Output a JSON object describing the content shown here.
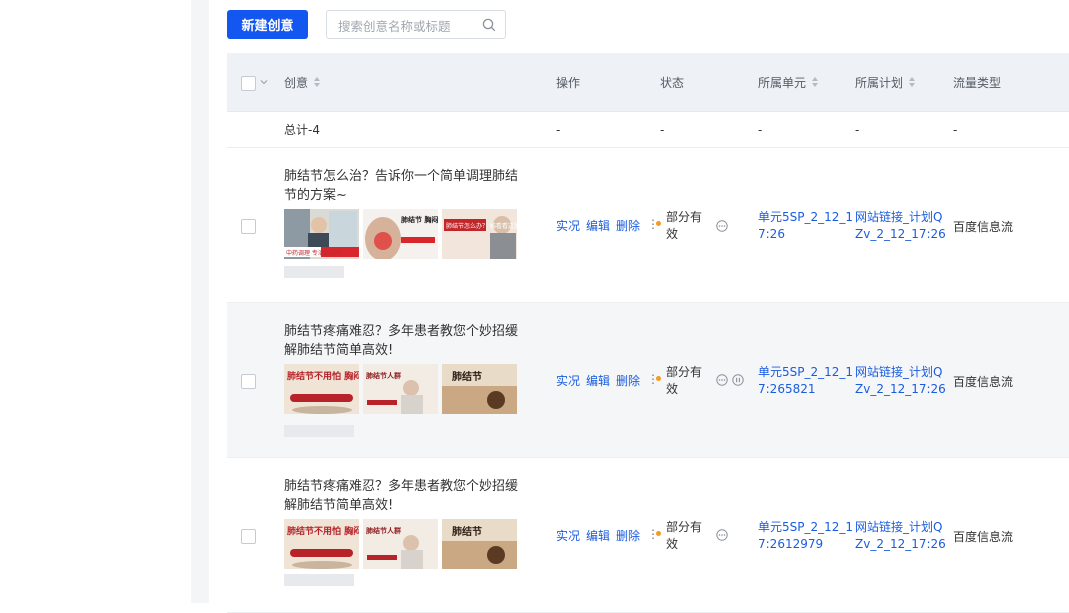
{
  "toolbar": {
    "new_button": "新建创意",
    "search_placeholder": "搜索创意名称或标题"
  },
  "columns": [
    "创意",
    "操作",
    "状态",
    "所属单元",
    "所属计划",
    "流量类型"
  ],
  "total": {
    "label": "总计-4",
    "ops": "-",
    "status": "-",
    "unit": "-",
    "plan": "-",
    "flow": "-"
  },
  "ops_labels": [
    "实况",
    "编辑",
    "删除"
  ],
  "rows": [
    {
      "title": "肺结节怎么治？告诉你一个简单调理肺结节的方案~",
      "status": "部分有效",
      "unit": [
        "单元5SP_2_12_1",
        "7:26"
      ],
      "plan": [
        "网站链接_计划Q",
        "Zv_2_12_17:26"
      ],
      "flow": "百度信息流",
      "thumb_texts": [
        "中药调理 专治肺结节",
        "肺结节 胸闷气短",
        "肺结节怎么办？ 姊看看这里！"
      ]
    },
    {
      "title": "肺结节疼痛难忍？多年患者教您个妙招缓解肺结节简单高效!",
      "status": "部分有效",
      "unit": [
        "单元5SP_2_12_1",
        "7:265821"
      ],
      "plan": [
        "网站链接_计划Q",
        "Zv_2_12_17:26"
      ],
      "flow": "百度信息流",
      "thumb_texts": [
        "肺结节不用怕 胸闷气短心慌憋闷",
        "肺结节人群",
        "肺结节"
      ]
    },
    {
      "title": "肺结节疼痛难忍？多年患者教您个妙招缓解肺结节简单高效!",
      "status": "部分有效",
      "unit": [
        "单元5SP_2_12_1",
        "7:2612979"
      ],
      "plan": [
        "网站链接_计划Q",
        "Zv_2_12_17:26"
      ],
      "flow": "百度信息流",
      "thumb_texts": [
        "肺结节不用怕 胸闷气短心慌憋闷",
        "肺结节人群",
        "肺结节"
      ]
    }
  ],
  "colors": {
    "primary": "#1456f0",
    "link": "#1a5ce0",
    "status_dot": "#f59a23",
    "header_bg": "#eef1f6"
  }
}
